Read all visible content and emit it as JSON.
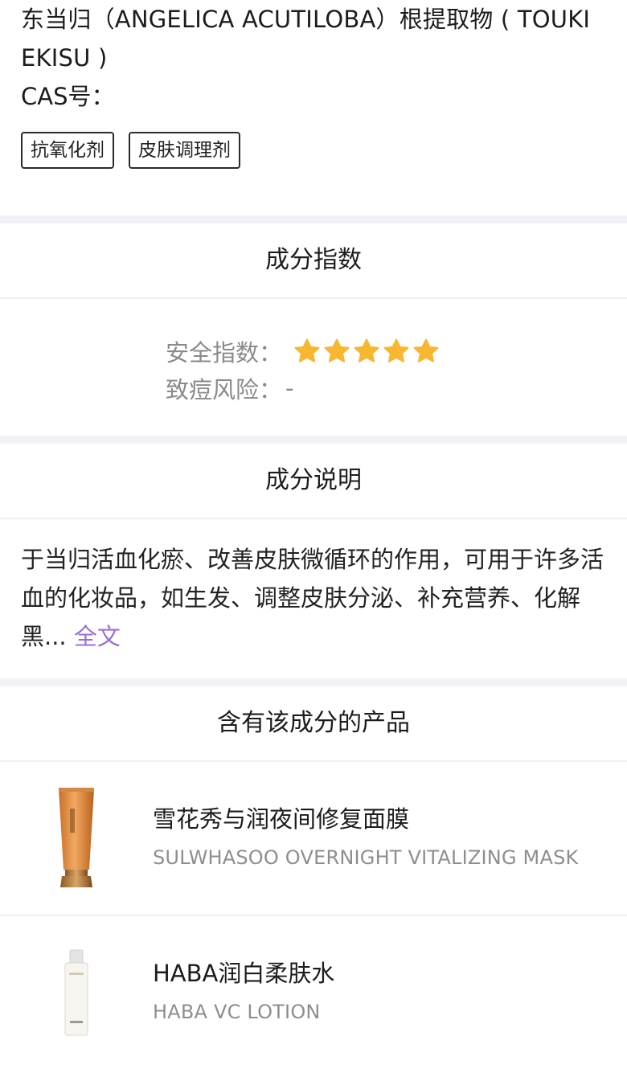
{
  "ingredient": {
    "title": "东当归（ANGELICA ACUTILOBA）根提取物 ( TOUKI EKISU )",
    "cas_label": "CAS号：",
    "tags": [
      "抗氧化剂",
      "皮肤调理剂"
    ]
  },
  "index_section": {
    "title": "成分指数",
    "safety_label": "安全指数：",
    "safety_stars": 5,
    "acne_label": "致痘风险：",
    "acne_value": "-",
    "star_color": "#f7b731"
  },
  "description_section": {
    "title": "成分说明",
    "text": "于当归活血化瘀、改善皮肤微循环的作用，可用于许多活血的化妆品，如生发、调整皮肤分泌、补充营养、化解黑...",
    "more_link": "全文",
    "link_color": "#9a6fd0"
  },
  "products_section": {
    "title": "含有该成分的产品",
    "items": [
      {
        "name": "雪花秀与润夜间修复面膜",
        "name_en": "SULWHASOO OVERNIGHT VITALIZING MASK",
        "thumb": "orange-tube-icon"
      },
      {
        "name": "HABA润白柔肤水",
        "name_en": "HABA VC LOTION",
        "thumb": "white-bottle-icon"
      }
    ]
  }
}
